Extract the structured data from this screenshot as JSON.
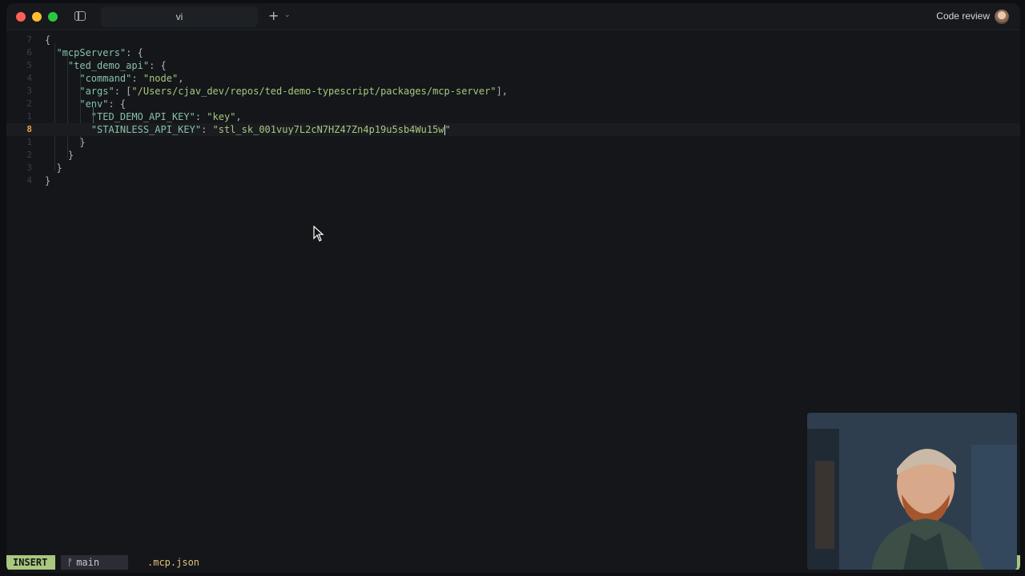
{
  "window": {
    "tab_title": "vi",
    "code_review_label": "Code review",
    "icons": [
      "close-icon",
      "minimize-icon",
      "maximize-icon",
      "sidebar-toggle-icon",
      "plus-icon",
      "chevron-down-icon",
      "avatar"
    ]
  },
  "editor": {
    "lines": [
      {
        "num": "7",
        "text": "{"
      },
      {
        "num": "6",
        "text": "  \"mcpServers\": {"
      },
      {
        "num": "5",
        "text": "    \"ted_demo_api\": {"
      },
      {
        "num": "4",
        "text": "      \"command\": \"node\","
      },
      {
        "num": "3",
        "text": "      \"args\": [\"/Users/cjav_dev/repos/ted-demo-typescript/packages/mcp-server\"],"
      },
      {
        "num": "2",
        "text": "      \"env\": {"
      },
      {
        "num": "1",
        "text": "        \"TED_DEMO_API_KEY\": \"key\","
      },
      {
        "num": "8",
        "text": "        \"STAINLESS_API_KEY\": \"stl_sk_001vuy7L2cN7HZ47Zn4p19u5sb4Wu15w\"",
        "current": true
      },
      {
        "num": "1",
        "text": "      }"
      },
      {
        "num": "2",
        "text": "    }"
      },
      {
        "num": "3",
        "text": "  }"
      },
      {
        "num": "4",
        "text": "}"
      }
    ]
  },
  "statusline": {
    "mode": "INSERT",
    "branch": "main",
    "filename": ".mcp.json"
  },
  "colors": {
    "accent": "#a9c77d",
    "current_line_number": "#f0a048",
    "filename": "#e5c07b"
  }
}
